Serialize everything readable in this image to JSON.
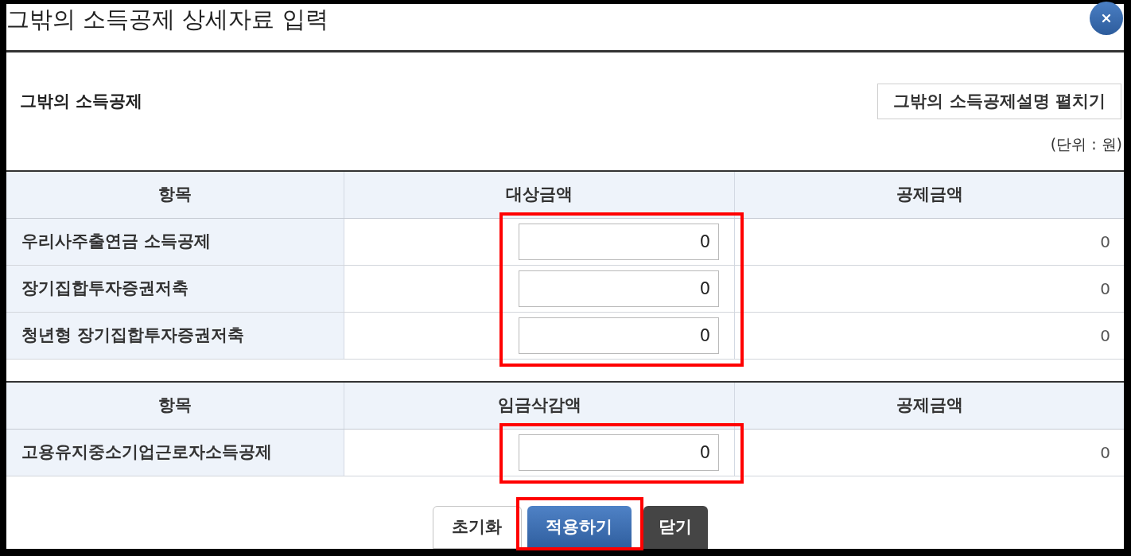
{
  "dialog": {
    "title": "그밖의 소득공제 상세자료 입력"
  },
  "section": {
    "heading": "그밖의 소득공제",
    "toggle_button": "그밖의 소득공제설명 펼치기",
    "unit_note": "(단위 : 원)"
  },
  "tables": [
    {
      "columns": [
        "항목",
        "대상금액",
        "공제금액"
      ],
      "input_highlighted": true,
      "rows": [
        {
          "item": "우리사주출연금 소득공제",
          "input_value": "0",
          "deduction": "0"
        },
        {
          "item": "장기집합투자증권저축",
          "input_value": "0",
          "deduction": "0"
        },
        {
          "item": "청년형 장기집합투자증권저축",
          "input_value": "0",
          "deduction": "0"
        }
      ]
    },
    {
      "columns": [
        "항목",
        "임금삭감액",
        "공제금액"
      ],
      "input_highlighted": true,
      "rows": [
        {
          "item": "고용유지중소기업근로자소득공제",
          "input_value": "0",
          "deduction": "0"
        }
      ]
    }
  ],
  "buttons": [
    {
      "label": "초기화",
      "kind": "reset",
      "highlighted": false
    },
    {
      "label": "적용하기",
      "kind": "primary",
      "highlighted": true
    },
    {
      "label": "닫기",
      "kind": "dark",
      "highlighted": false
    }
  ]
}
